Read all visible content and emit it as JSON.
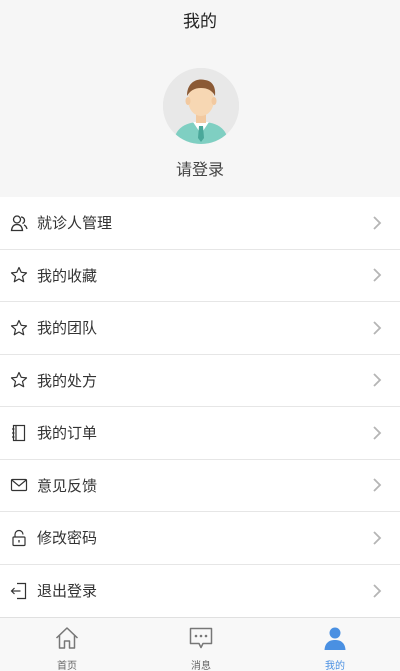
{
  "header": {
    "title": "我的"
  },
  "profile": {
    "login_prompt": "请登录",
    "avatar_icon": "user-avatar-icon"
  },
  "menu": {
    "items": [
      {
        "label": "就诊人管理",
        "icon": "patients-icon"
      },
      {
        "label": "我的收藏",
        "icon": "star-icon"
      },
      {
        "label": "我的团队",
        "icon": "star-icon"
      },
      {
        "label": "我的处方",
        "icon": "star-icon"
      },
      {
        "label": "我的订单",
        "icon": "notebook-icon"
      },
      {
        "label": "意见反馈",
        "icon": "mail-icon"
      },
      {
        "label": "修改密码",
        "icon": "lock-icon"
      },
      {
        "label": "退出登录",
        "icon": "logout-icon"
      }
    ]
  },
  "tabbar": {
    "tabs": [
      {
        "label": "首页",
        "icon": "home-icon",
        "active": false
      },
      {
        "label": "消息",
        "icon": "message-icon",
        "active": false
      },
      {
        "label": "我的",
        "icon": "user-icon",
        "active": true
      }
    ],
    "active_color": "#4a90e2"
  }
}
